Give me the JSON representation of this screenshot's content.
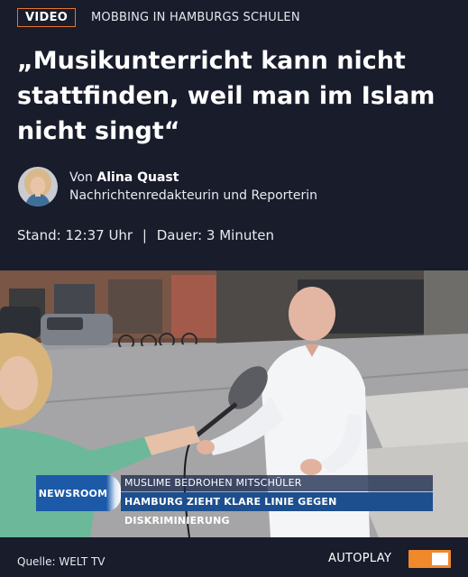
{
  "header": {
    "badge": "VIDEO",
    "kicker": "MOBBING IN HAMBURGS SCHULEN",
    "headline": "„Musikunterricht kann nicht stattfinden, weil man im Islam nicht singt“"
  },
  "author": {
    "prefix": "Von",
    "name": "Alina Quast",
    "role": "Nachrichtenredakteurin und Reporterin"
  },
  "meta": {
    "stand": "Stand: 12:37 Uhr",
    "separator": "|",
    "duration": "Dauer: 3 Minuten"
  },
  "video": {
    "brand": "NEWSROOM",
    "ticker_top": "MUSLIME BEDROHEN MITSCHÜLER",
    "ticker_bottom": "HAMBURG ZIEHT KLARE LINIE GEGEN DISKRIMINIERUNG"
  },
  "footer": {
    "source": "Quelle: WELT TV",
    "autoplay_label": "AUTOPLAY"
  },
  "colors": {
    "background": "#181c2b",
    "accent": "#e8742c",
    "toggle": "#f0882c",
    "lower_third_blue": "#1c5aa8"
  },
  "icons": {
    "avatar": "author-avatar",
    "toggle": "autoplay-toggle"
  }
}
